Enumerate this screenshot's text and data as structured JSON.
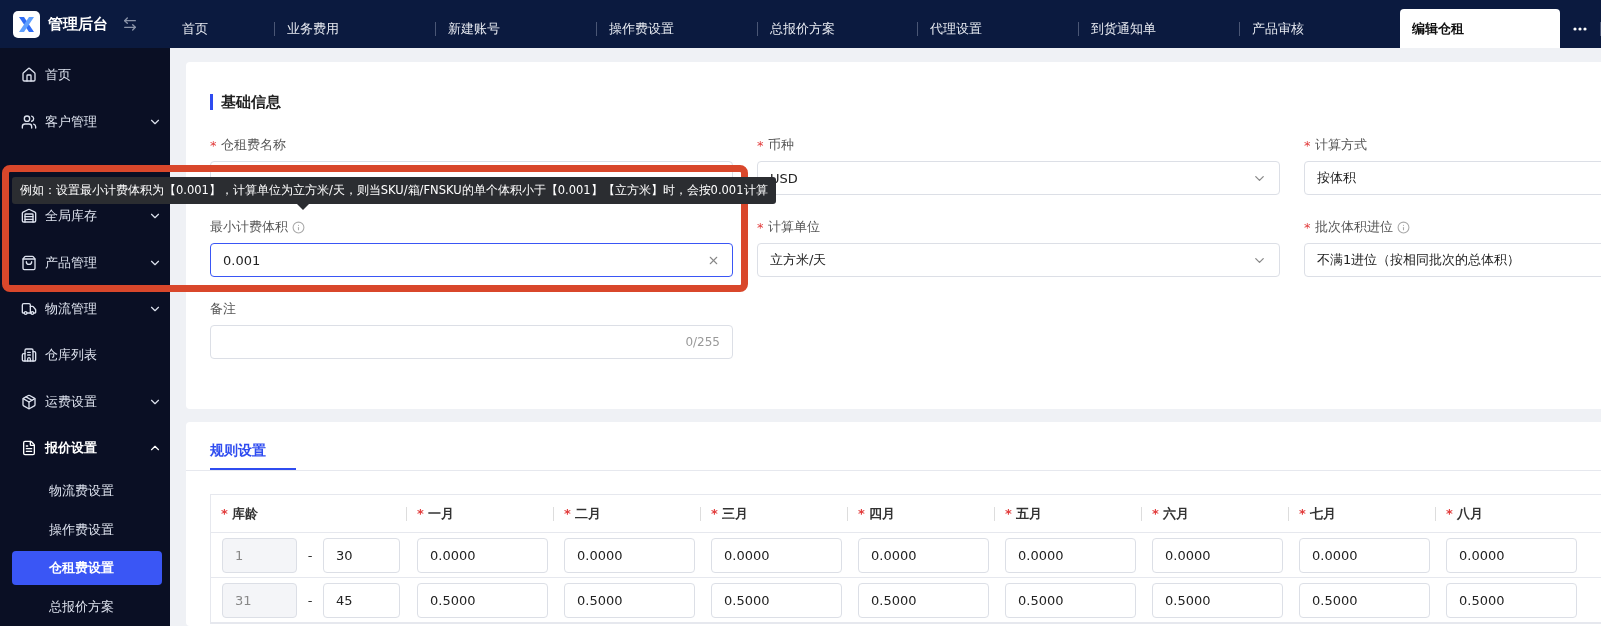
{
  "app": {
    "title": "管理后台"
  },
  "top_tabs": [
    {
      "label": "首页",
      "selected": false
    },
    {
      "label": "业务费用",
      "selected": false
    },
    {
      "label": "新建账号",
      "selected": false
    },
    {
      "label": "操作费设置",
      "selected": false
    },
    {
      "label": "总报价方案",
      "selected": false
    },
    {
      "label": "代理设置",
      "selected": false
    },
    {
      "label": "到货通知单",
      "selected": false
    },
    {
      "label": "产品审核",
      "selected": false
    },
    {
      "label": "编辑仓租",
      "selected": true
    }
  ],
  "sidebar": {
    "items": [
      {
        "label": "首页"
      },
      {
        "label": "客户管理",
        "expanded": false
      },
      {
        "label": "全局库存",
        "expanded": false
      },
      {
        "label": "产品管理",
        "expanded": false
      },
      {
        "label": "物流管理",
        "expanded": false
      },
      {
        "label": "仓库列表"
      },
      {
        "label": "运费设置",
        "expanded": false
      },
      {
        "label": "报价设置",
        "expanded": true,
        "children": [
          {
            "label": "物流费设置",
            "selected": false
          },
          {
            "label": "操作费设置",
            "selected": false
          },
          {
            "label": "仓租费设置",
            "selected": true
          },
          {
            "label": "总报价方案",
            "selected": false
          }
        ]
      }
    ]
  },
  "basic_info": {
    "title": "基础信息",
    "required_mark": "*",
    "fields": [
      {
        "label": "仓租费名称",
        "required": true,
        "kind": "input"
      },
      {
        "label": "币种",
        "required": true,
        "kind": "select",
        "value": "USD"
      },
      {
        "label": "计算方式",
        "required": true,
        "kind": "input",
        "value": "按体积"
      },
      {
        "label": "最小计费体积",
        "required": false,
        "info": true,
        "kind": "input",
        "value": "0.001",
        "focused": true,
        "clearable": true
      },
      {
        "label": "计算单位",
        "required": true,
        "kind": "select",
        "value": "立方米/天"
      },
      {
        "label": "批次体积进位",
        "required": true,
        "info": true,
        "kind": "input",
        "value": "不满1进位（按相同批次的总体积）"
      },
      {
        "label": "备注",
        "required": false,
        "kind": "input",
        "counter": "0/255"
      }
    ]
  },
  "tooltip": {
    "text": "例如：设置最小计费体积为【0.001】，计算单位为立方米/天，则当SKU/箱/FNSKU的单个体积小于【0.001】【立方米】时，会按0.001计算"
  },
  "rules": {
    "tabs": [
      {
        "label": "规则设置",
        "selected": true
      }
    ],
    "table": {
      "required_mark": "*",
      "columns": [
        {
          "label": "库龄",
          "required": true
        },
        {
          "label": "一月",
          "required": true
        },
        {
          "label": "二月",
          "required": true
        },
        {
          "label": "三月",
          "required": true
        },
        {
          "label": "四月",
          "required": true
        },
        {
          "label": "五月",
          "required": true
        },
        {
          "label": "六月",
          "required": true
        },
        {
          "label": "七月",
          "required": true
        },
        {
          "label": "八月",
          "required": true
        }
      ],
      "rows": [
        {
          "from": "1",
          "to": "30",
          "separator": "-",
          "values": [
            "0.0000",
            "0.0000",
            "0.0000",
            "0.0000",
            "0.0000",
            "0.0000",
            "0.0000",
            "0.0000"
          ]
        },
        {
          "from": "31",
          "to": "45",
          "separator": "-",
          "values": [
            "0.5000",
            "0.5000",
            "0.5000",
            "0.5000",
            "0.5000",
            "0.5000",
            "0.5000",
            "0.5000"
          ]
        }
      ]
    }
  }
}
